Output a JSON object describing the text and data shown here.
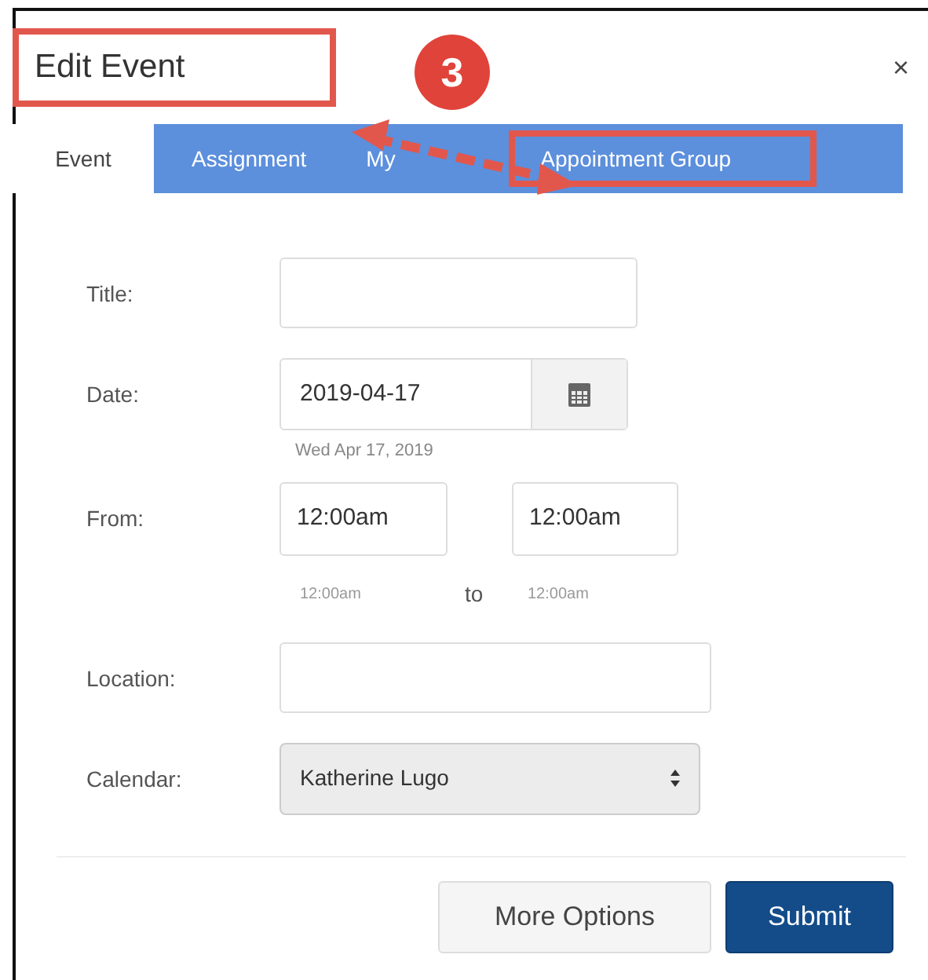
{
  "dialog": {
    "title": "Edit Event",
    "title_highlighted": true,
    "close": "×"
  },
  "annotation": {
    "badge": "3"
  },
  "tabs": [
    {
      "label": "Event",
      "selected": true,
      "highlighted": false
    },
    {
      "label": "Assignment",
      "selected": false,
      "highlighted": false
    },
    {
      "label": "My",
      "selected": false,
      "highlighted": false
    },
    {
      "label": "Appointment Group",
      "selected": false,
      "highlighted": true
    }
  ],
  "fields": [
    {
      "kind": "text",
      "label": "Title:"
    },
    {
      "kind": "date",
      "label": "Date:",
      "value": "2019-04-17",
      "hint": "Wed Apr 17, 2019"
    },
    {
      "kind": "time_range",
      "label": "From:",
      "start": "12:00am",
      "end": "12:00am",
      "start_hint": "12:00am",
      "separator": "to",
      "end_hint": "12:00am"
    },
    {
      "kind": "text",
      "label": "Location:"
    },
    {
      "kind": "select",
      "label": "Calendar:",
      "value": "Katherine Lugo"
    }
  ],
  "buttons": [
    {
      "label": "More Options",
      "kind": "secondary"
    },
    {
      "label": "Submit",
      "kind": "primary"
    }
  ]
}
